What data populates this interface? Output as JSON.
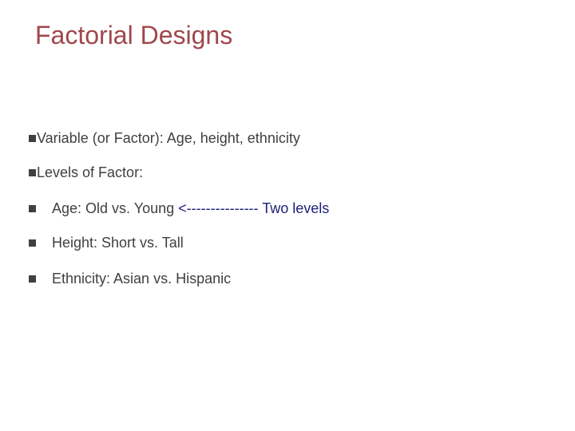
{
  "slide": {
    "title": "Factorial Designs",
    "colors": {
      "title": "#a0474c",
      "body_text": "#404040",
      "bullet": "#404040",
      "annotation": "#1f1f7a"
    },
    "bullets": [
      {
        "level": 1,
        "bullet_icon": "square-bullet-icon",
        "text": "Variable (or Factor): Age, height, ethnicity"
      },
      {
        "level": 1,
        "bullet_icon": "square-bullet-icon",
        "text": "Levels of Factor:"
      },
      {
        "level": 2,
        "bullet_icon": "square-bullet-icon",
        "text": "Age: Old vs. Young ",
        "annotation": "<--------------- Two levels"
      },
      {
        "level": 2,
        "bullet_icon": "square-bullet-icon",
        "text": "Height: Short vs. Tall"
      },
      {
        "level": 2,
        "bullet_icon": "square-bullet-icon",
        "text": "Ethnicity: Asian vs. Hispanic"
      }
    ]
  }
}
